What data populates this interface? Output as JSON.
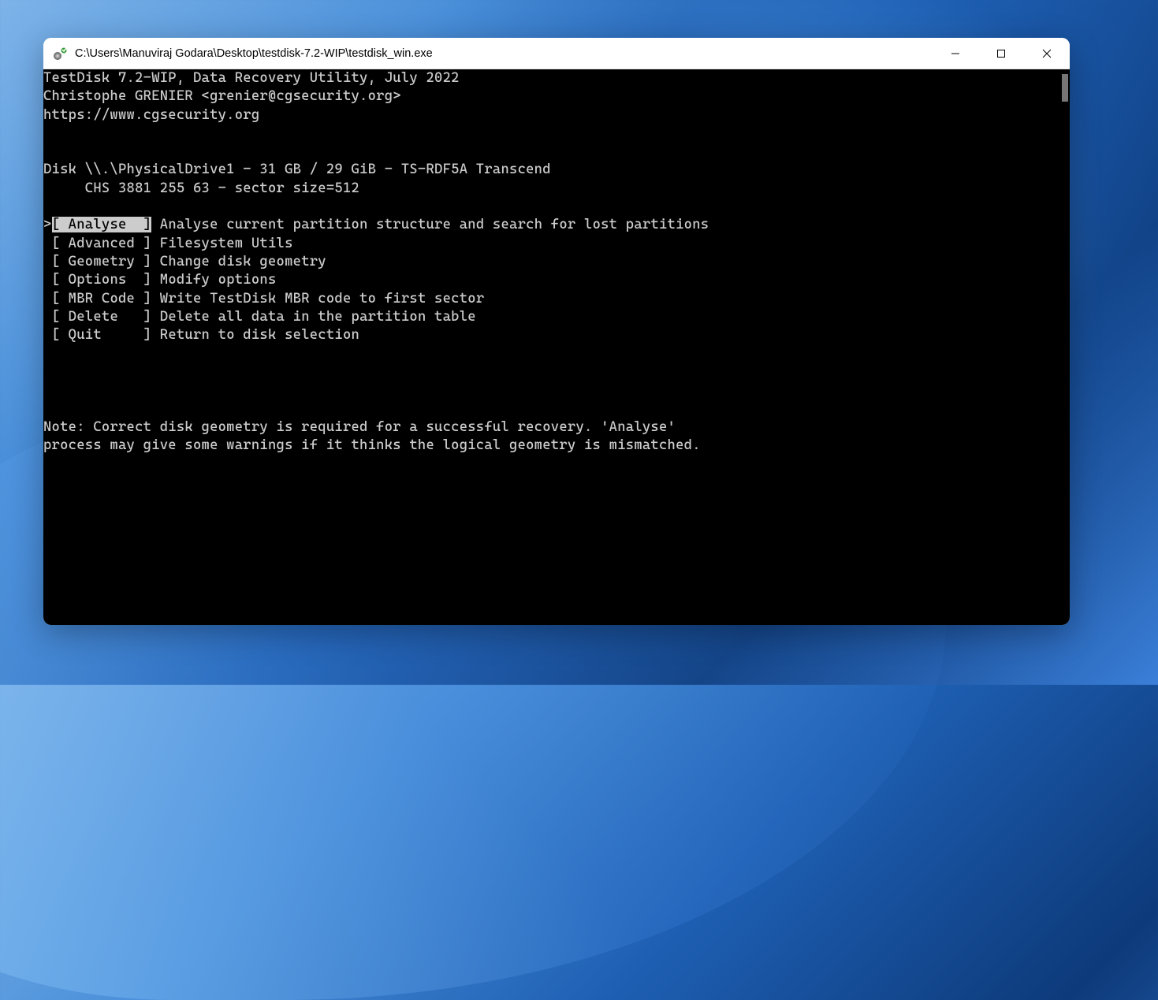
{
  "window": {
    "title": "C:\\Users\\Manuviraj Godara\\Desktop\\testdisk-7.2-WIP\\testdisk_win.exe"
  },
  "header": {
    "line1": "TestDisk 7.2-WIP, Data Recovery Utility, July 2022",
    "line2": "Christophe GRENIER <grenier@cgsecurity.org>",
    "line3": "https://www.cgsecurity.org"
  },
  "disk": {
    "line1": "Disk \\\\.\\PhysicalDrive1 - 31 GB / 29 GiB - TS-RDF5A Transcend",
    "line2": "     CHS 3881 255 63 - sector size=512"
  },
  "menu": {
    "items": [
      {
        "prefix": ">",
        "label": "[ Analyse  ]",
        "desc": " Analyse current partition structure and search for lost partitions",
        "selected": true
      },
      {
        "prefix": " ",
        "label": "[ Advanced ]",
        "desc": " Filesystem Utils",
        "selected": false
      },
      {
        "prefix": " ",
        "label": "[ Geometry ]",
        "desc": " Change disk geometry",
        "selected": false
      },
      {
        "prefix": " ",
        "label": "[ Options  ]",
        "desc": " Modify options",
        "selected": false
      },
      {
        "prefix": " ",
        "label": "[ MBR Code ]",
        "desc": " Write TestDisk MBR code to first sector",
        "selected": false
      },
      {
        "prefix": " ",
        "label": "[ Delete   ]",
        "desc": " Delete all data in the partition table",
        "selected": false
      },
      {
        "prefix": " ",
        "label": "[ Quit     ]",
        "desc": " Return to disk selection",
        "selected": false
      }
    ]
  },
  "note": {
    "line1": "Note: Correct disk geometry is required for a successful recovery. 'Analyse'",
    "line2": "process may give some warnings if it thinks the logical geometry is mismatched."
  }
}
